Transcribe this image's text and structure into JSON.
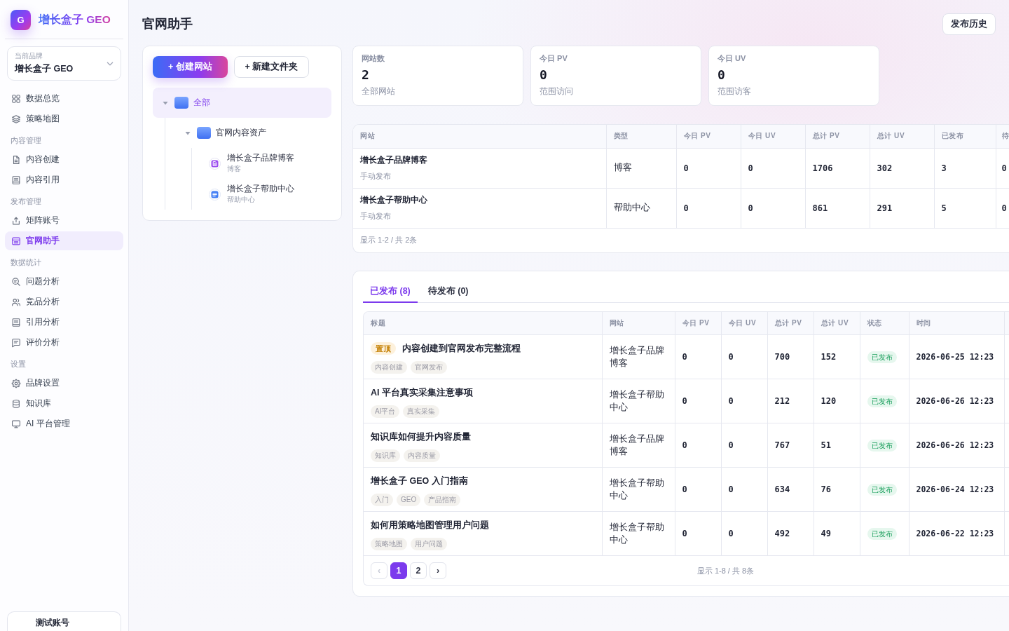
{
  "sidebar": {
    "logo": {
      "letter": "G",
      "title": "增长盒子 GEO"
    },
    "brand_select": {
      "label": "当前品牌",
      "value": "增长盒子 GEO"
    },
    "nav": [
      {
        "items": [
          {
            "label": "数据总览",
            "selected": false
          },
          {
            "label": "策略地图",
            "selected": false
          }
        ]
      },
      {
        "heading": "内容管理",
        "items": [
          {
            "label": "内容创建",
            "selected": false
          },
          {
            "label": "内容引用",
            "selected": false
          }
        ]
      },
      {
        "heading": "发布管理",
        "items": [
          {
            "label": "矩阵账号",
            "selected": false
          },
          {
            "label": "官网助手",
            "selected": true
          }
        ]
      },
      {
        "heading": "数据统计",
        "items": [
          {
            "label": "问题分析",
            "selected": false
          },
          {
            "label": "竞品分析",
            "selected": false
          },
          {
            "label": "引用分析",
            "selected": false
          },
          {
            "label": "评价分析",
            "selected": false
          }
        ]
      },
      {
        "heading": "设置",
        "items": [
          {
            "label": "品牌设置",
            "selected": false
          },
          {
            "label": "知识库",
            "selected": false
          },
          {
            "label": "AI 平台管理",
            "selected": false
          }
        ]
      }
    ],
    "account": {
      "label": "测试账号"
    }
  },
  "header": {
    "title": "官网助手",
    "history_button": "发布历史"
  },
  "tree_panel": {
    "actions": [
      {
        "kind": "primary",
        "label": "+ 创建网站"
      },
      {
        "kind": "secondary",
        "label": "+ 新建文件夹"
      }
    ],
    "tree": {
      "kind": "folder",
      "label": "全部",
      "selected": true,
      "expanded": true,
      "children": [
        {
          "kind": "folder",
          "label": "官网内容资产",
          "selected": false,
          "expanded": true,
          "children": [
            {
              "kind": "blog",
              "label": "增长盒子品牌博客",
              "subtitle": "博客",
              "selected": false
            },
            {
              "kind": "help_center",
              "label": "增长盒子帮助中心",
              "subtitle": "帮助中心",
              "selected": false
            }
          ]
        }
      ]
    }
  },
  "stats": [
    {
      "label": "网站数",
      "value": "2",
      "caption": "全部网站"
    },
    {
      "label": "今日 PV",
      "value": "0",
      "caption": "范围访问"
    },
    {
      "label": "今日 UV",
      "value": "0",
      "caption": "范围访客"
    }
  ],
  "sites_table": {
    "columns": [
      "网站",
      "类型",
      "今日 PV",
      "今日 UV",
      "总计 PV",
      "总计 UV",
      "已发布",
      "待"
    ],
    "rows": [
      {
        "name": "增长盒子品牌博客",
        "mode": "手动发布",
        "type": "博客",
        "today_pv": "0",
        "today_uv": "0",
        "total_pv": "1706",
        "total_uv": "302",
        "published": "3",
        "pending": "0"
      },
      {
        "name": "增长盒子帮助中心",
        "mode": "手动发布",
        "type": "帮助中心",
        "today_pv": "0",
        "today_uv": "0",
        "total_pv": "861",
        "total_uv": "291",
        "published": "5",
        "pending": "0"
      }
    ],
    "footer": "显示 1-2 / 共 2条"
  },
  "posts": {
    "tabs": [
      {
        "label": "已发布 (8)",
        "selected": true
      },
      {
        "label": "待发布 (0)",
        "selected": false
      }
    ],
    "columns": [
      "标题",
      "网站",
      "今日 PV",
      "今日 UV",
      "总计 PV",
      "总计 UV",
      "状态",
      "时间"
    ],
    "rows": [
      {
        "badge": "置顶",
        "title": "内容创建到官网发布完整流程",
        "tags": [
          "内容创建",
          "官网发布"
        ],
        "site": "增长盒子品牌博客",
        "today_pv": "0",
        "today_uv": "0",
        "total_pv": "700",
        "total_uv": "152",
        "status": "已发布",
        "time": "2026-06-25 12:23"
      },
      {
        "title": "AI 平台真实采集注意事项",
        "tags": [
          "AI平台",
          "真实采集"
        ],
        "site": "增长盒子帮助中心",
        "today_pv": "0",
        "today_uv": "0",
        "total_pv": "212",
        "total_uv": "120",
        "status": "已发布",
        "time": "2026-06-26 12:23"
      },
      {
        "title": "知识库如何提升内容质量",
        "tags": [
          "知识库",
          "内容质量"
        ],
        "site": "增长盒子品牌博客",
        "today_pv": "0",
        "today_uv": "0",
        "total_pv": "767",
        "total_uv": "51",
        "status": "已发布",
        "time": "2026-06-26 12:23"
      },
      {
        "title": "增长盒子 GEO 入门指南",
        "tags": [
          "入门",
          "GEO",
          "产品指南"
        ],
        "site": "增长盒子帮助中心",
        "today_pv": "0",
        "today_uv": "0",
        "total_pv": "634",
        "total_uv": "76",
        "status": "已发布",
        "time": "2026-06-24 12:23"
      },
      {
        "title": "如何用策略地图管理用户问题",
        "tags": [
          "策略地图",
          "用户问题"
        ],
        "site": "增长盒子帮助中心",
        "today_pv": "0",
        "today_uv": "0",
        "total_pv": "492",
        "total_uv": "49",
        "status": "已发布",
        "time": "2026-06-22 12:23"
      }
    ],
    "pagination": {
      "prev": {
        "label": "‹",
        "disabled": true
      },
      "pages": [
        {
          "label": "1",
          "selected": true
        },
        {
          "label": "2",
          "selected": false
        }
      ],
      "next": {
        "label": "›",
        "disabled": false
      },
      "summary": "显示 1-8 / 共 8条"
    }
  }
}
